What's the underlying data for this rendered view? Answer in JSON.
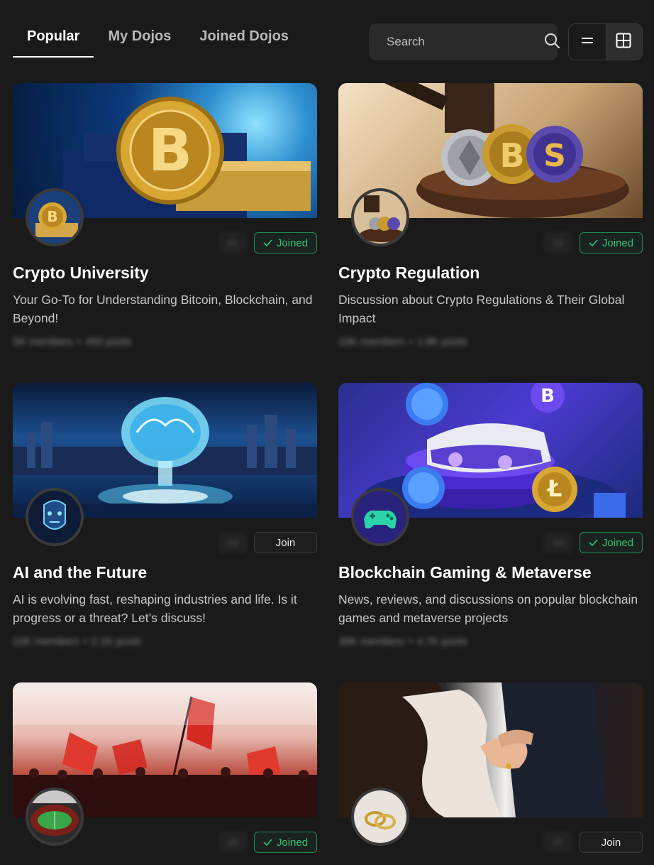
{
  "tabs": [
    {
      "label": "Popular",
      "active": true
    },
    {
      "label": "My Dojos",
      "active": false
    },
    {
      "label": "Joined Dojos",
      "active": false
    }
  ],
  "search": {
    "placeholder": "Search"
  },
  "view_toggle": {
    "options": [
      "list-icon",
      "grid-icon"
    ],
    "selected": "grid-icon"
  },
  "colors": {
    "background": "#1a1a1a",
    "joined_green": "#32c277",
    "text_primary": "#ffffff",
    "text_secondary": "#c7c7c7"
  },
  "cards": [
    {
      "title": "Crypto University",
      "description": "Your Go-To for Understanding Bitcoin, Blockchain, and Beyond!",
      "rank": "#1",
      "status": "Joined",
      "members": "5K members",
      "posts": "450 posts",
      "banner_icon": "bitcoin-coin-banner"
    },
    {
      "title": "Crypto Regulation",
      "description": "Discussion about Crypto Regulations & Their Global Impact",
      "rank": "#2",
      "status": "Joined",
      "members": "10K members",
      "posts": "1.8K posts",
      "banner_icon": "gavel-coins-banner"
    },
    {
      "title": "AI and the Future",
      "description": "AI is evolving fast, reshaping industries and life. Is it progress or a threat? Let’s discuss!",
      "rank": "#3",
      "status": "Join",
      "members": "22K members",
      "posts": "2.1K posts",
      "banner_icon": "ai-brain-banner"
    },
    {
      "title": "Blockchain Gaming & Metaverse",
      "description": "News, reviews, and discussions on popular blockchain games and metaverse projects",
      "rank": "#4",
      "status": "Joined",
      "members": "30K members",
      "posts": "4.7K posts",
      "banner_icon": "vr-headset-banner"
    },
    {
      "title": "",
      "description": "",
      "rank": "#5",
      "status": "Joined",
      "members": "",
      "posts": "",
      "banner_icon": "football-fans-banner"
    },
    {
      "title": "",
      "description": "",
      "rank": "#7",
      "status": "Join",
      "members": "",
      "posts": "",
      "banner_icon": "wedding-banner"
    }
  ]
}
